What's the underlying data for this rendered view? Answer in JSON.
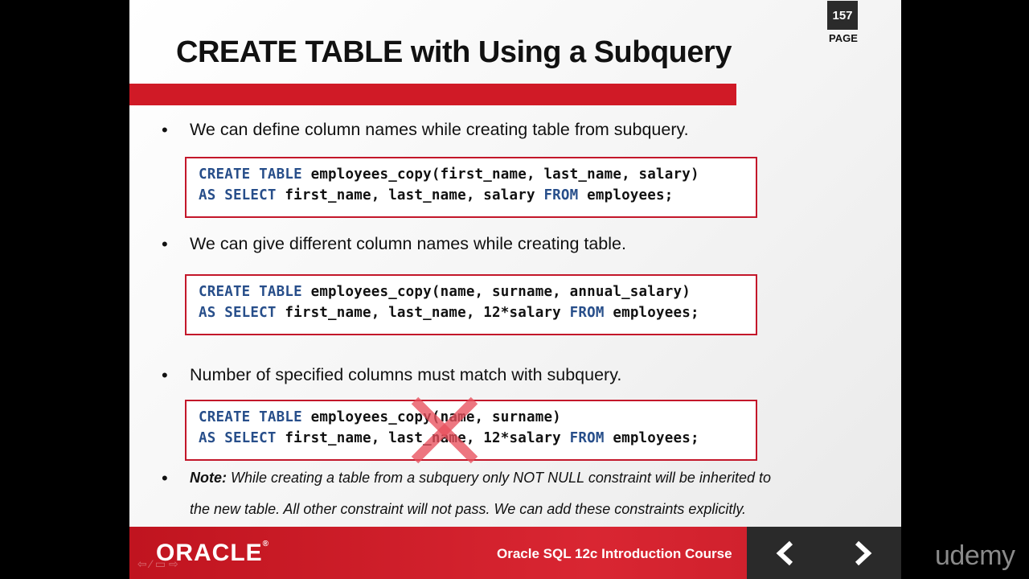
{
  "page": {
    "number": "157",
    "label": "PAGE"
  },
  "slide_title": "CREATE TABLE with Using a Subquery",
  "bullets": [
    "We can define column names while creating  table from subquery.",
    "We can give different column names while creating table.",
    "Number of specified columns must match with subquery."
  ],
  "code_blocks": [
    {
      "l1_kw": "CREATE TABLE",
      "l1_rest": " employees_copy(first_name, last_name, salary)",
      "l2_kw1": "AS SELECT",
      "l2_mid": " first_name, last_name, salary ",
      "l2_kw2": "FROM",
      "l2_end": " employees;"
    },
    {
      "l1_kw": "CREATE TABLE",
      "l1_rest": " employees_copy(name, surname, annual_salary)",
      "l2_kw1": "AS SELECT",
      "l2_mid": " first_name, last_name, 12*salary ",
      "l2_kw2": "FROM",
      "l2_end": " employees;"
    },
    {
      "l1_kw": "CREATE TABLE",
      "l1_rest": " employees_copy(name, surname)",
      "l2_kw1": "AS SELECT",
      "l2_mid": " first_name, last_name, 12*salary ",
      "l2_kw2": "FROM",
      "l2_end": " employees;"
    }
  ],
  "note": {
    "label": "Note:",
    "line1": " While creating a table from a subquery only NOT NULL constraint will be inherited to",
    "line2": "the new table. All other constraint will not pass. We can add these constraints explicitly."
  },
  "footer": {
    "logo_text": "ORACLE",
    "logo_mark": "®",
    "course_title": "Oracle SQL 12c Introduction Course",
    "prev_icon": "chevron-left-icon",
    "next_icon": "chevron-right-icon",
    "player_controls": "⇦ ⁄ ▭ ⇨"
  },
  "watermark": "udemy",
  "colors": {
    "accent_red": "#d01a26",
    "keyword_blue": "#274e8a",
    "nav_dark": "#2a2a2a"
  }
}
